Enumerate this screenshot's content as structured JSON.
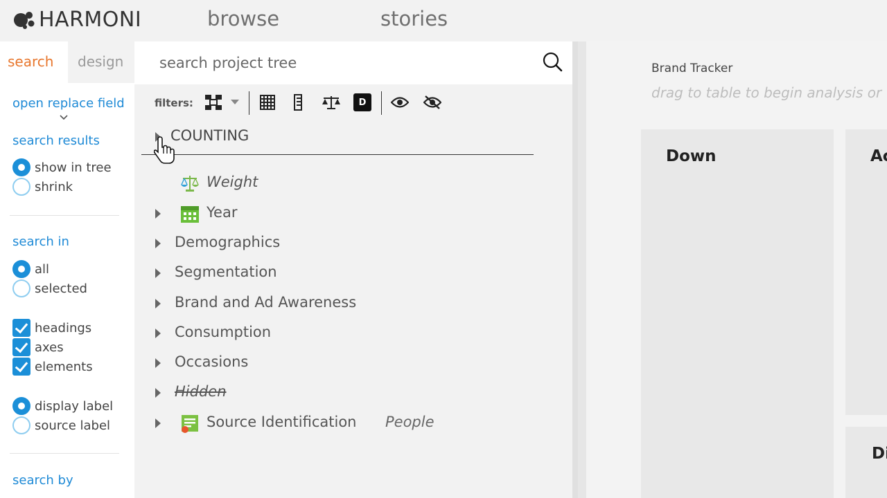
{
  "topbar": {
    "logo_text": "HARMONI",
    "nav": [
      "browse",
      "stories"
    ]
  },
  "left_panel": {
    "tabs": {
      "search": "search",
      "design": "design"
    },
    "open_replace_field": "open replace field",
    "search_results": {
      "heading": "search results",
      "options": [
        {
          "label": "show in tree",
          "selected": true
        },
        {
          "label": "shrink",
          "selected": false
        }
      ]
    },
    "search_in": {
      "heading": "search in",
      "options": [
        {
          "label": "all",
          "selected": true
        },
        {
          "label": "selected",
          "selected": false
        }
      ]
    },
    "checkboxes": [
      {
        "label": "headings",
        "checked": true
      },
      {
        "label": "axes",
        "checked": true
      },
      {
        "label": "elements",
        "checked": true
      }
    ],
    "label_mode": {
      "options": [
        {
          "label": "display label",
          "selected": true
        },
        {
          "label": "source label",
          "selected": false
        }
      ]
    },
    "search_by": "search by"
  },
  "tree": {
    "search_placeholder": "search project tree",
    "filters_label": "filters:",
    "filter_d_label": "D",
    "items": [
      {
        "label": "COUNTING",
        "expandable": true
      },
      {
        "label": "Weight",
        "expandable": false,
        "icon": "scale-icon"
      },
      {
        "label": "Year",
        "expandable": true,
        "icon": "calendar-icon"
      },
      {
        "label": "Demographics",
        "expandable": true
      },
      {
        "label": "Segmentation",
        "expandable": true
      },
      {
        "label": "Brand and Ad Awareness",
        "expandable": true
      },
      {
        "label": "Consumption",
        "expandable": true
      },
      {
        "label": "Occasions",
        "expandable": true
      },
      {
        "label": "Hidden",
        "expandable": true,
        "style": "italic-strikethrough"
      },
      {
        "label": "Source Identification",
        "expandable": true,
        "icon": "source-id-icon",
        "tag": "People"
      }
    ]
  },
  "main": {
    "title": "Brand Tracker",
    "hint": "drag to table to begin analysis or",
    "cards": [
      {
        "title": "Down"
      },
      {
        "title": "Ac"
      },
      {
        "title": "Di"
      }
    ]
  },
  "colors": {
    "accent_orange": "#e8772e",
    "link_blue": "#1e8ad6",
    "control_blue": "#1b8fd8",
    "calendar_green": "#6abf3a"
  }
}
